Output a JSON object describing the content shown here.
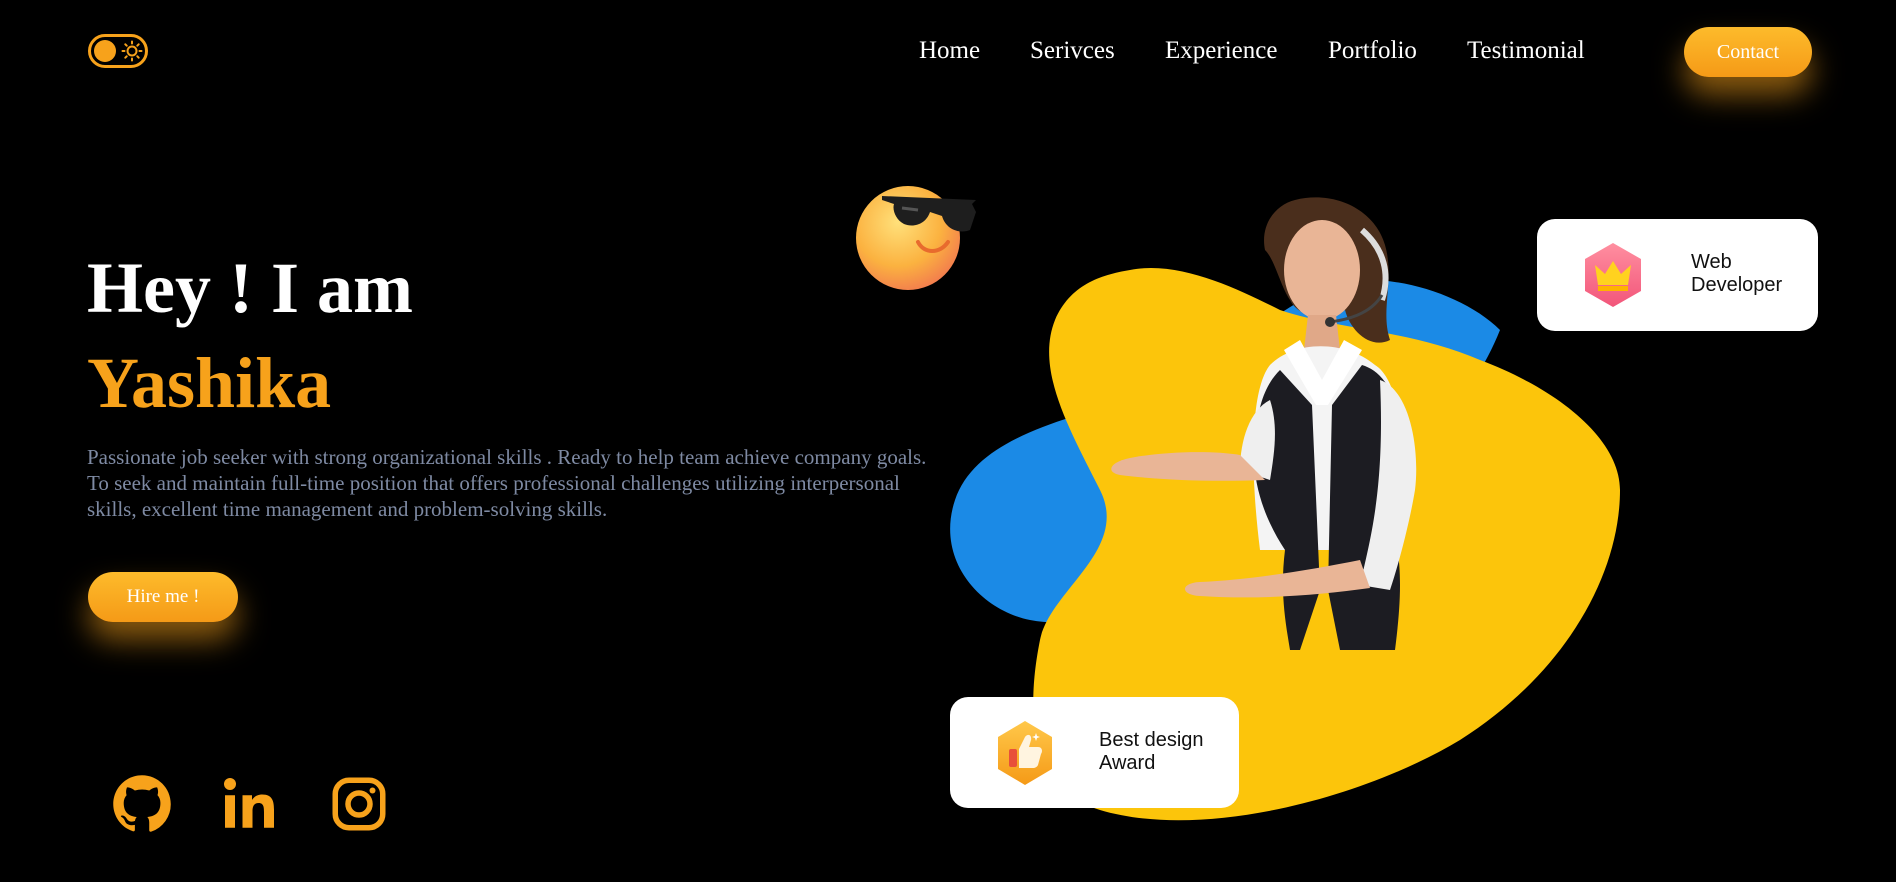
{
  "nav": {
    "items": [
      {
        "label": "Home"
      },
      {
        "label": "Serivces"
      },
      {
        "label": "Experience"
      },
      {
        "label": "Portfolio"
      },
      {
        "label": "Testimonial"
      }
    ],
    "contact_label": "Contact"
  },
  "theme_toggle": {
    "icon": "sun-icon",
    "state": "dark"
  },
  "hero": {
    "greeting": "Hey ! I am",
    "name": "Yashika",
    "description": "Passionate job seeker with strong organizational skills . Ready to help team achieve company goals. To seek and maintain full-time position that offers professional challenges utilizing interpersonal skills, excellent time management and problem-solving skills.",
    "cta_label": "Hire me !"
  },
  "social": [
    {
      "icon": "github-icon"
    },
    {
      "icon": "linkedin-icon"
    },
    {
      "icon": "instagram-icon"
    }
  ],
  "cards": {
    "web_dev": {
      "line1": "Web",
      "line2": "Developer",
      "icon": "crown-icon"
    },
    "award": {
      "line1": "Best design",
      "line2": "Award",
      "icon": "thumbs-up-icon"
    }
  },
  "colors": {
    "accent": "#f7a21b",
    "background": "#000000",
    "blob_yellow": "#fcc50b",
    "blob_blue": "#1b8ae6",
    "text_muted": "#7e8aa3"
  }
}
